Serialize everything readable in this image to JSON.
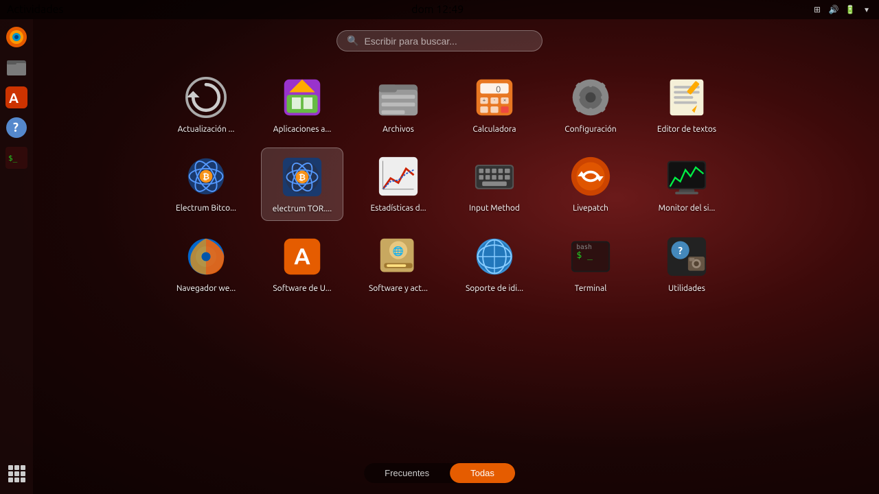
{
  "topbar": {
    "left_label": "Actividades",
    "time": "dom 12:49"
  },
  "search": {
    "placeholder": "Escribir para buscar..."
  },
  "apps": [
    {
      "id": "update",
      "label": "Actualización ...",
      "icon_type": "update"
    },
    {
      "id": "appchooser",
      "label": "Aplicaciones a...",
      "icon_type": "appchooser"
    },
    {
      "id": "files",
      "label": "Archivos",
      "icon_type": "files"
    },
    {
      "id": "calculator",
      "label": "Calculadora",
      "icon_type": "calculator"
    },
    {
      "id": "settings",
      "label": "Configuración",
      "icon_type": "settings"
    },
    {
      "id": "texteditor",
      "label": "Editor de textos",
      "icon_type": "texteditor"
    },
    {
      "id": "electrum",
      "label": "Electrum Bitco...",
      "icon_type": "electrum"
    },
    {
      "id": "electrum-tor",
      "label": "electrum TOR....",
      "icon_type": "electrum_tor"
    },
    {
      "id": "statistics",
      "label": "Estadísticas d...",
      "icon_type": "statistics"
    },
    {
      "id": "inputmethod",
      "label": "Input Method",
      "icon_type": "inputmethod"
    },
    {
      "id": "livepatch",
      "label": "Livepatch",
      "icon_type": "livepatch"
    },
    {
      "id": "sysmonitor",
      "label": "Monitor del si...",
      "icon_type": "sysmonitor"
    },
    {
      "id": "firefox",
      "label": "Navegador we...",
      "icon_type": "firefox"
    },
    {
      "id": "software",
      "label": "Software de U...",
      "icon_type": "software"
    },
    {
      "id": "softwareupd",
      "label": "Software y act...",
      "icon_type": "softwareupd"
    },
    {
      "id": "langsupport",
      "label": "Soporte de idi...",
      "icon_type": "langsupport"
    },
    {
      "id": "terminal",
      "label": "Terminal",
      "icon_type": "terminal"
    },
    {
      "id": "utilities",
      "label": "Utilidades",
      "icon_type": "utilities"
    }
  ],
  "tabs": [
    {
      "label": "Frecuentes",
      "active": false
    },
    {
      "label": "Todas",
      "active": true
    }
  ],
  "sidebar": {
    "items": [
      {
        "id": "firefox",
        "icon_type": "firefox_dock"
      },
      {
        "id": "files",
        "icon_type": "files_dock"
      },
      {
        "id": "font",
        "icon_type": "font_dock"
      },
      {
        "id": "help",
        "icon_type": "help_dock"
      },
      {
        "id": "terminal",
        "icon_type": "terminal_dock"
      }
    ]
  }
}
